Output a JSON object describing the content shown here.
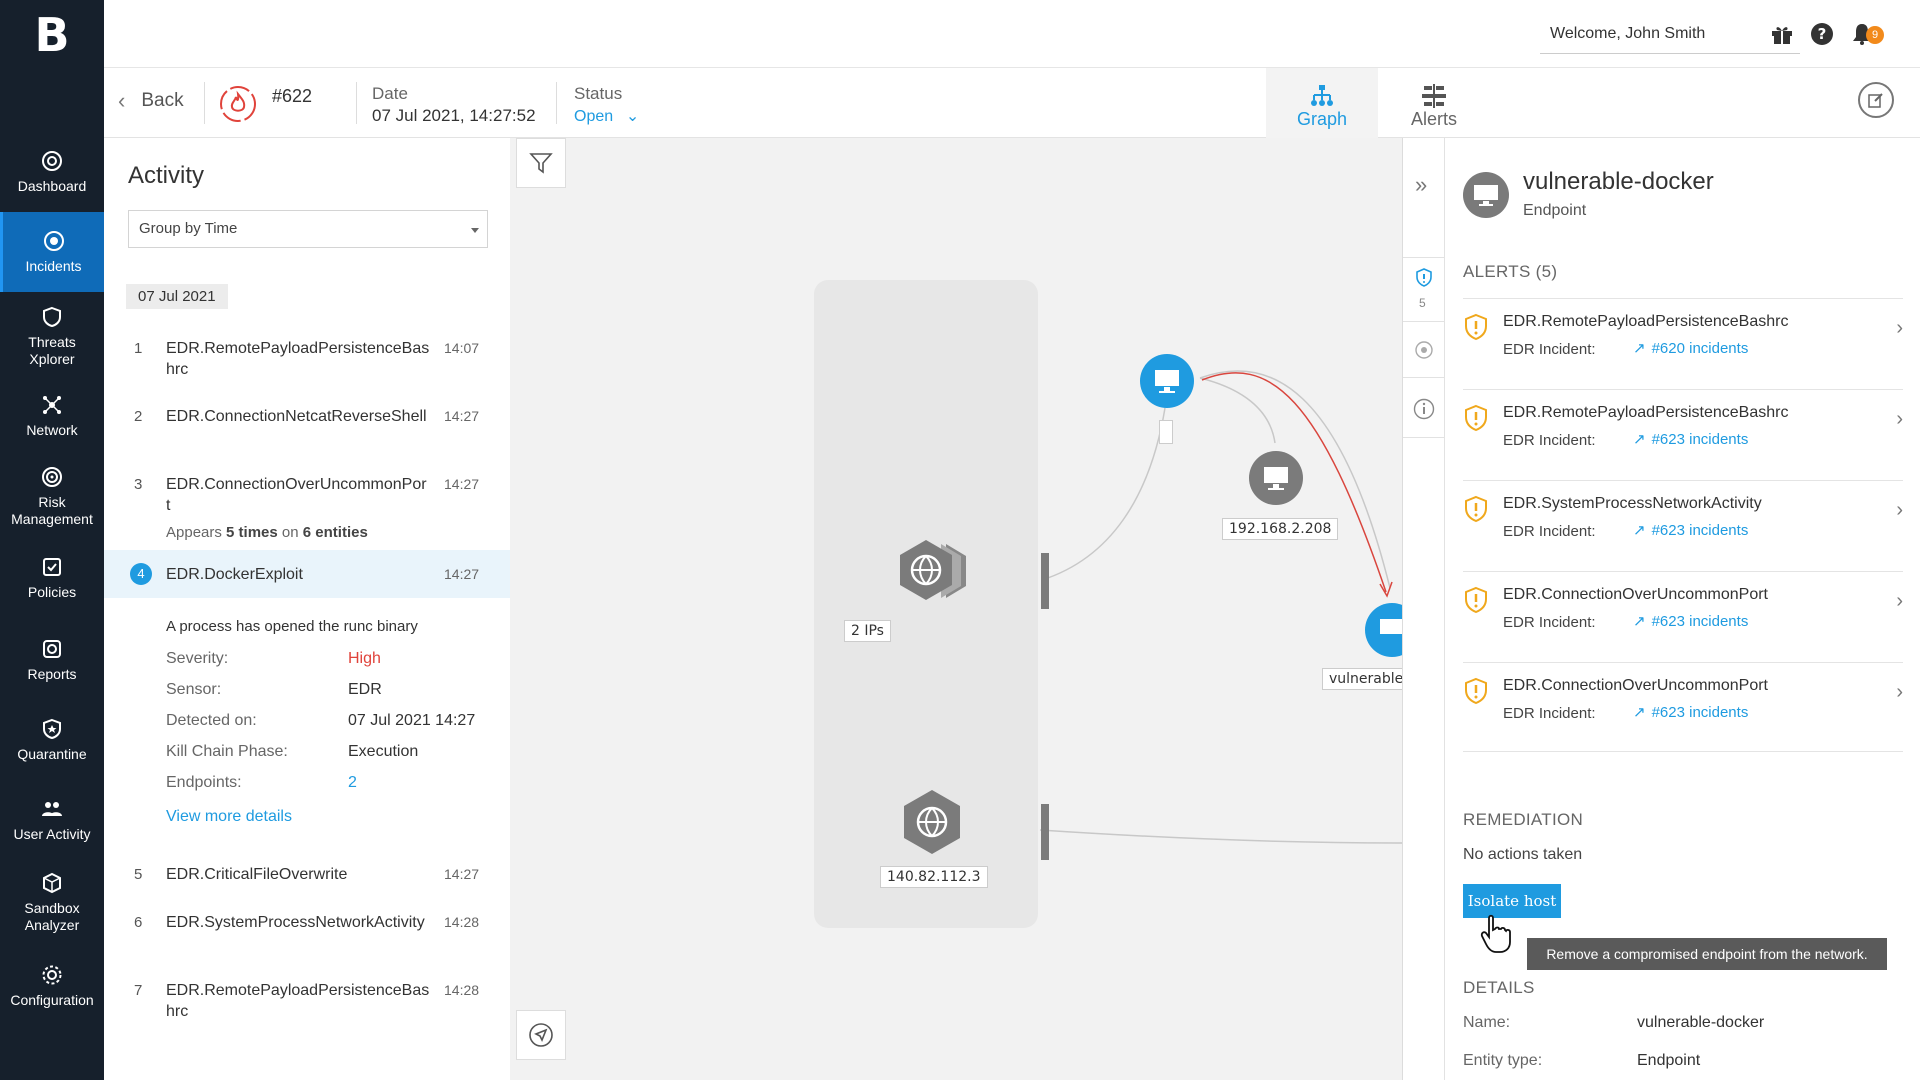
{
  "brand": {
    "logo_letter": "B"
  },
  "nav": [
    {
      "label": "Dashboard",
      "icon": "dashboard-icon",
      "active": false
    },
    {
      "label": "Incidents",
      "icon": "incidents-icon",
      "active": true
    },
    {
      "label": "Threats\nXplorer",
      "icon": "threats-icon",
      "active": false
    },
    {
      "label": "Network",
      "icon": "network-icon",
      "active": false
    },
    {
      "label": "Risk\nManagement",
      "icon": "risk-icon",
      "active": false
    },
    {
      "label": "Policies",
      "icon": "policies-icon",
      "active": false
    },
    {
      "label": "Reports",
      "icon": "reports-icon",
      "active": false
    },
    {
      "label": "Quarantine",
      "icon": "quarantine-icon",
      "active": false
    },
    {
      "label": "User Activity",
      "icon": "user-activity-icon",
      "active": false
    },
    {
      "label": "Sandbox\nAnalyzer",
      "icon": "sandbox-icon",
      "active": false
    },
    {
      "label": "Configuration",
      "icon": "configuration-icon",
      "active": false
    }
  ],
  "topbar": {
    "welcome": "Welcome, John Smith",
    "notification_count": "9"
  },
  "header": {
    "back_label": "Back",
    "incident_id": "#622",
    "date_label": "Date",
    "date_value": "07 Jul 2021, 14:27:52",
    "status_label": "Status",
    "status_value": "Open",
    "tab_graph": "Graph",
    "tab_alerts": "Alerts"
  },
  "activity": {
    "title": "Activity",
    "group_by": "Group by Time",
    "date_chip": "07 Jul 2021",
    "items": [
      {
        "num": "1",
        "name": "EDR.RemotePayloadPersistenceBashrc",
        "time": "14:07"
      },
      {
        "num": "2",
        "name": "EDR.ConnectionNetcatReverseShell",
        "time": "14:27"
      },
      {
        "num": "3",
        "name": "EDR.ConnectionOverUncommonPort",
        "time": "14:27",
        "appears_prefix": "Appears",
        "appears_times": "5 times",
        "appears_on": "on",
        "appears_entities": "6 entities"
      },
      {
        "num": "4",
        "name": "EDR.DockerExploit",
        "time": "14:27"
      },
      {
        "num": "5",
        "name": "EDR.CriticalFileOverwrite",
        "time": "14:27"
      },
      {
        "num": "6",
        "name": "EDR.SystemProcessNetworkActivity",
        "time": "14:28"
      },
      {
        "num": "7",
        "name": "EDR.RemotePayloadPersistenceBashrc",
        "time": "14:28"
      }
    ],
    "selected_detail": {
      "description": "A process has opened the runc binary",
      "rows": [
        {
          "label": "Severity:",
          "value": "High"
        },
        {
          "label": "Sensor:",
          "value": "EDR"
        },
        {
          "label": "Detected on:",
          "value": "07 Jul 2021 14:27"
        },
        {
          "label": "Kill Chain Phase:",
          "value": "Execution"
        },
        {
          "label": "Endpoints:",
          "value": "2"
        }
      ],
      "view_more": "View more details"
    }
  },
  "graph": {
    "nodes": [
      {
        "label": "2 IPs"
      },
      {
        "label": "140.82.112.3"
      },
      {
        "label": "192.168.2.208"
      },
      {
        "label": "vulnerable-"
      }
    ]
  },
  "entity": {
    "name": "vulnerable-docker",
    "type": "Endpoint",
    "alert_count": "5",
    "alerts_title": "ALERTS (5)",
    "alerts": [
      {
        "name": "EDR.RemotePayloadPersistenceBashrc",
        "sub": "EDR Incident:",
        "link": "#620 incidents"
      },
      {
        "name": "EDR.RemotePayloadPersistenceBashrc",
        "sub": "EDR Incident:",
        "link": "#623 incidents"
      },
      {
        "name": "EDR.SystemProcessNetworkActivity",
        "sub": "EDR Incident:",
        "link": "#623 incidents"
      },
      {
        "name": "EDR.ConnectionOverUncommonPort",
        "sub": "EDR Incident:",
        "link": "#623 incidents"
      },
      {
        "name": "EDR.ConnectionOverUncommonPort",
        "sub": "EDR Incident:",
        "link": "#623 incidents"
      }
    ],
    "remediation_title": "REMEDIATION",
    "remediation_status": "No actions taken",
    "isolate_label": "Isolate host",
    "isolate_tooltip": "Remove a compromised endpoint from the network.",
    "details_title": "DETAILS",
    "details": [
      {
        "label": "Name:",
        "value": "vulnerable-docker"
      },
      {
        "label": "Entity type:",
        "value": "Endpoint"
      }
    ]
  },
  "colors": {
    "accent": "#1f9be0",
    "sidebar": "#16202c",
    "active_nav": "#0f6bb8",
    "severity_high": "#e0433b",
    "warning": "#f0a81c",
    "graph_edge_red": "#d9463e"
  }
}
